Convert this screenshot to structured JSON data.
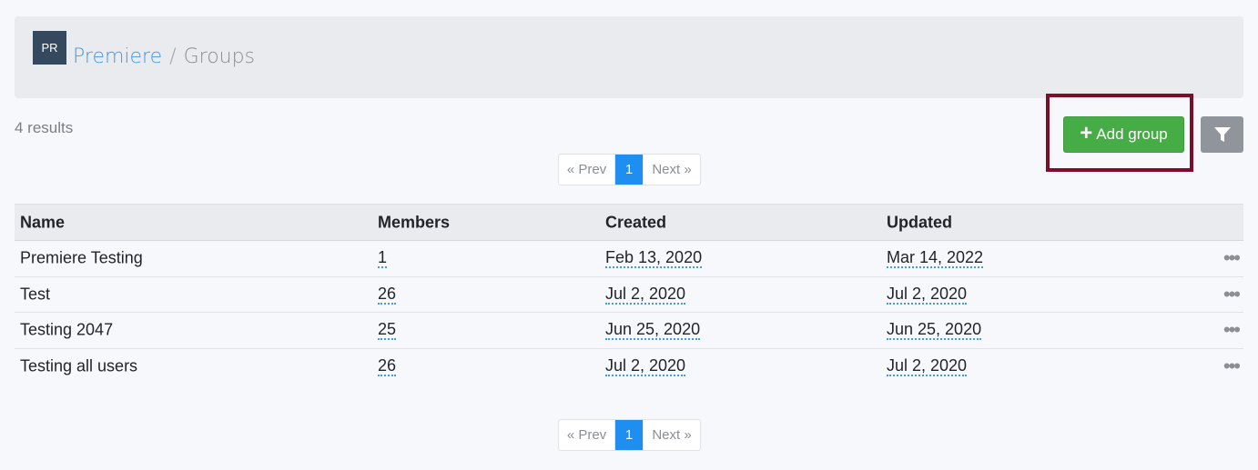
{
  "header": {
    "avatar_initials": "PR",
    "breadcrumb": {
      "parent": "Premiere",
      "separator": "/",
      "current": "Groups"
    }
  },
  "results_count": "4 results",
  "toolbar": {
    "add_group_label": "Add group",
    "add_icon": "plus-icon",
    "filter_icon": "filter-icon"
  },
  "pagination": {
    "prev": "« Prev",
    "current_page": "1",
    "next": "Next »"
  },
  "table": {
    "columns": [
      "Name",
      "Members",
      "Created",
      "Updated"
    ],
    "rows": [
      {
        "name": "Premiere Testing",
        "members": "1",
        "created": "Feb 13, 2020",
        "updated": "Mar 14, 2022"
      },
      {
        "name": "Test",
        "members": "26",
        "created": "Jul 2, 2020",
        "updated": "Jul 2, 2020"
      },
      {
        "name": "Testing 2047",
        "members": "25",
        "created": "Jun 25, 2020",
        "updated": "Jun 25, 2020"
      },
      {
        "name": "Testing all users",
        "members": "26",
        "created": "Jul 2, 2020",
        "updated": "Jul 2, 2020"
      }
    ],
    "row_action_icon": "ellipsis-icon"
  },
  "colors": {
    "accent_blue": "#3d9be9",
    "add_button_green": "#46ac46",
    "highlight_border": "#7b0f2a",
    "filter_button_gray": "#8f959b",
    "avatar_bg": "#34495e"
  }
}
